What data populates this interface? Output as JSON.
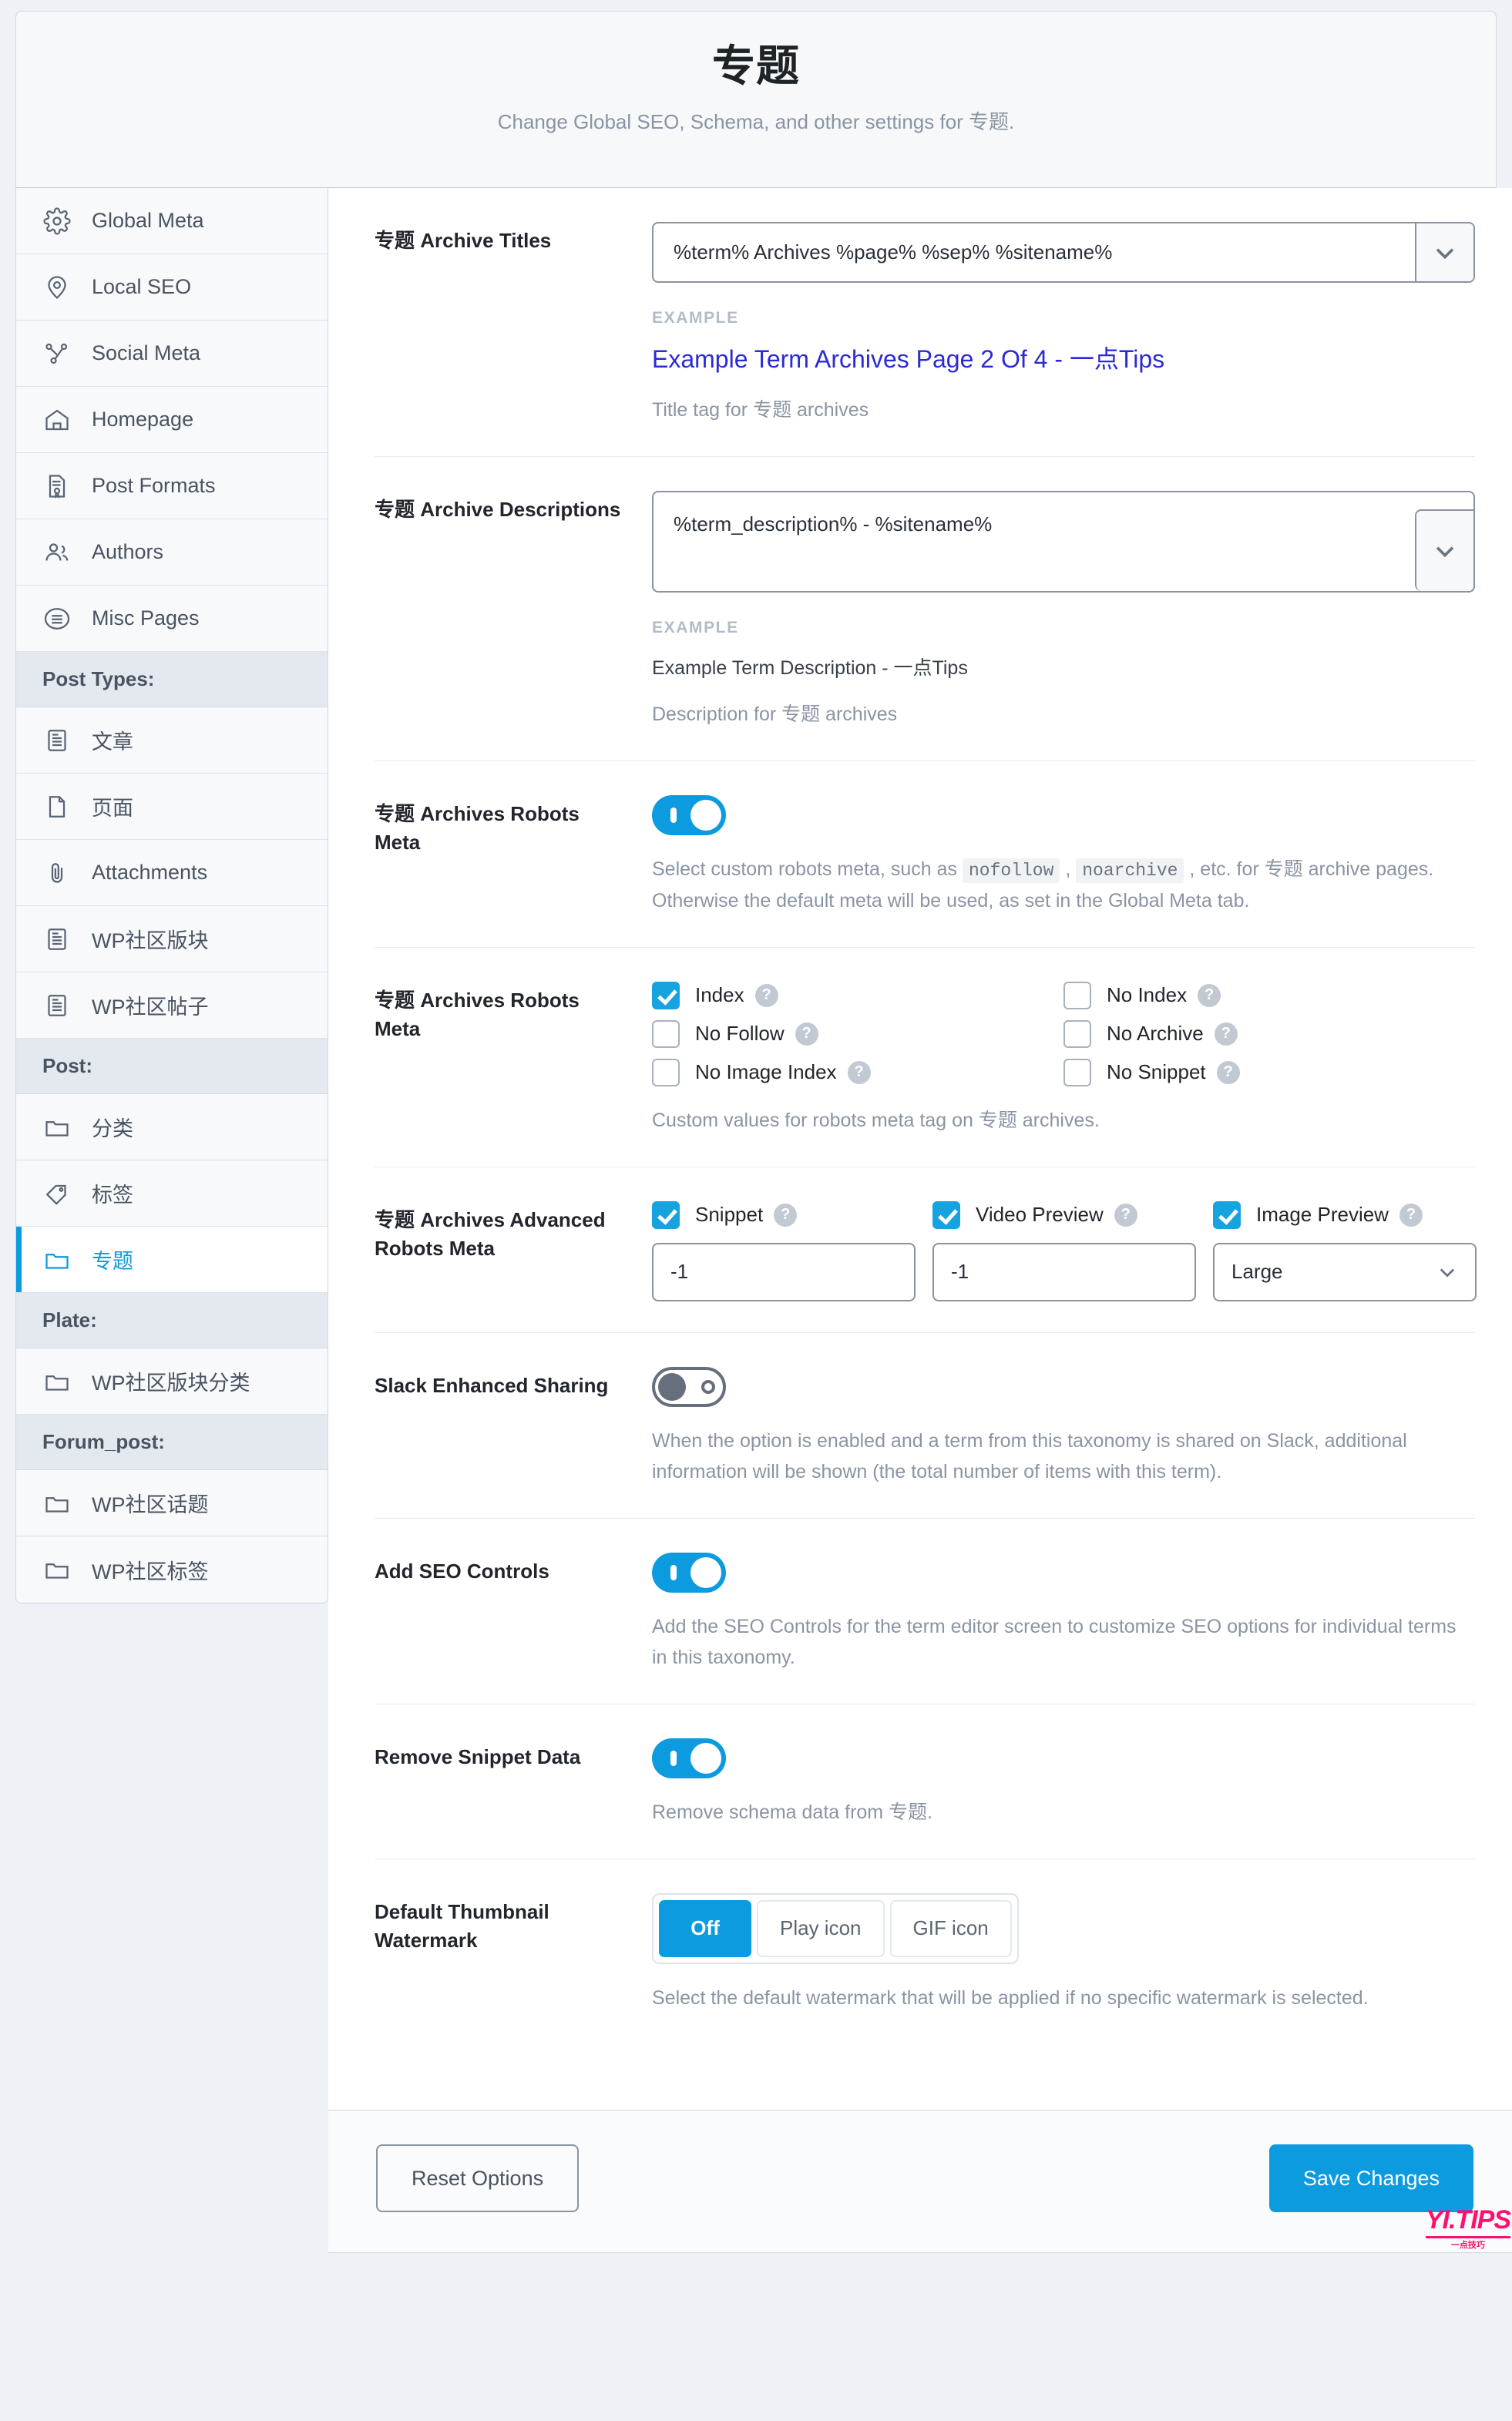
{
  "header": {
    "title": "专题",
    "subtitle": "Change Global SEO, Schema, and other settings for 专题."
  },
  "sidebar": {
    "items": [
      {
        "label": "Global Meta",
        "icon": "gear-icon",
        "type": "item",
        "active": false
      },
      {
        "label": "Local SEO",
        "icon": "map-pin-icon",
        "type": "item",
        "active": false
      },
      {
        "label": "Social Meta",
        "icon": "share-nodes-icon",
        "type": "item",
        "active": false
      },
      {
        "label": "Homepage",
        "icon": "home-icon",
        "type": "item",
        "active": false
      },
      {
        "label": "Post Formats",
        "icon": "document-badge-icon",
        "type": "item",
        "active": false
      },
      {
        "label": "Authors",
        "icon": "users-icon",
        "type": "item",
        "active": false
      },
      {
        "label": "Misc Pages",
        "icon": "list-circle-icon",
        "type": "item",
        "active": false
      },
      {
        "label": "Post Types:",
        "type": "group"
      },
      {
        "label": "文章",
        "icon": "article-icon",
        "type": "item",
        "active": false
      },
      {
        "label": "页面",
        "icon": "page-icon",
        "type": "item",
        "active": false
      },
      {
        "label": "Attachments",
        "icon": "paperclip-icon",
        "type": "item",
        "active": false
      },
      {
        "label": "WP社区版块",
        "icon": "article-icon",
        "type": "item",
        "active": false
      },
      {
        "label": "WP社区帖子",
        "icon": "article-icon",
        "type": "item",
        "active": false
      },
      {
        "label": "Post:",
        "type": "group"
      },
      {
        "label": "分类",
        "icon": "folder-icon",
        "type": "item",
        "active": false
      },
      {
        "label": "标签",
        "icon": "tag-icon",
        "type": "item",
        "active": false
      },
      {
        "label": "专题",
        "icon": "folder-icon",
        "type": "item",
        "active": true
      },
      {
        "label": "Plate:",
        "type": "group"
      },
      {
        "label": "WP社区版块分类",
        "icon": "folder-icon",
        "type": "item",
        "active": false
      },
      {
        "label": "Forum_post:",
        "type": "group"
      },
      {
        "label": "WP社区话题",
        "icon": "folder-icon",
        "type": "item",
        "active": false
      },
      {
        "label": "WP社区标签",
        "icon": "folder-icon",
        "type": "item",
        "active": false
      }
    ]
  },
  "settings": {
    "archive_titles": {
      "label": "专题 Archive Titles",
      "value": "%term% Archives %page% %sep% %sitename%",
      "example_label": "EXAMPLE",
      "example_value": "Example Term Archives Page 2 Of 4 - 一点Tips",
      "help": "Title tag for 专题 archives"
    },
    "archive_descriptions": {
      "label": "专题 Archive Descriptions",
      "value": "%term_description% - %sitename%",
      "example_label": "EXAMPLE",
      "example_value": "Example Term Description - 一点Tips",
      "help": "Description for 专题 archives"
    },
    "robots_meta_toggle": {
      "label": "专题 Archives Robots Meta",
      "state": "on",
      "help_pre": "Select custom robots meta, such as ",
      "code1": "nofollow",
      "help_mid1": " , ",
      "code2": "noarchive",
      "help_post": " , etc. for 专题 archive pages. Otherwise the default meta will be used, as set in the Global Meta tab."
    },
    "robots_meta_checks": {
      "label": "专题 Archives Robots Meta",
      "help": "Custom values for robots meta tag on 专题 archives.",
      "options": [
        {
          "label": "Index",
          "checked": true
        },
        {
          "label": "No Index",
          "checked": false
        },
        {
          "label": "No Follow",
          "checked": false
        },
        {
          "label": "No Archive",
          "checked": false
        },
        {
          "label": "No Image Index",
          "checked": false
        },
        {
          "label": "No Snippet",
          "checked": false
        }
      ],
      "help_icon": "?"
    },
    "advanced_robots": {
      "label": "专题 Archives Advanced Robots Meta",
      "columns": [
        {
          "label": "Snippet",
          "checked": true,
          "value": "-1",
          "control": "input"
        },
        {
          "label": "Video Preview",
          "checked": true,
          "value": "-1",
          "control": "input"
        },
        {
          "label": "Image Preview",
          "checked": true,
          "value": "Large",
          "control": "select"
        }
      ]
    },
    "slack_sharing": {
      "label": "Slack Enhanced Sharing",
      "state": "off",
      "help": "When the option is enabled and a term from this taxonomy is shared on Slack, additional information will be shown (the total number of items with this term)."
    },
    "seo_controls": {
      "label": "Add SEO Controls",
      "state": "on",
      "help": "Add the SEO Controls for the term editor screen to customize SEO options for individual terms in this taxonomy."
    },
    "remove_snippet": {
      "label": "Remove Snippet Data",
      "state": "on",
      "help": "Remove schema data from 专题."
    },
    "watermark": {
      "label": "Default Thumbnail Watermark",
      "options": [
        "Off",
        "Play icon",
        "GIF icon"
      ],
      "selected": "Off",
      "help": "Select the default watermark that will be applied if no specific watermark is selected."
    }
  },
  "footer": {
    "reset_label": "Reset Options",
    "save_label": "Save Changes",
    "watermark_text": "YI.TIPS",
    "watermark_sub": "一点技巧"
  },
  "colors": {
    "accent": "#0c9bdf",
    "checkbox": "#17a2e0",
    "link": "#2a2ad6",
    "watermark": "#ff0f6e"
  }
}
